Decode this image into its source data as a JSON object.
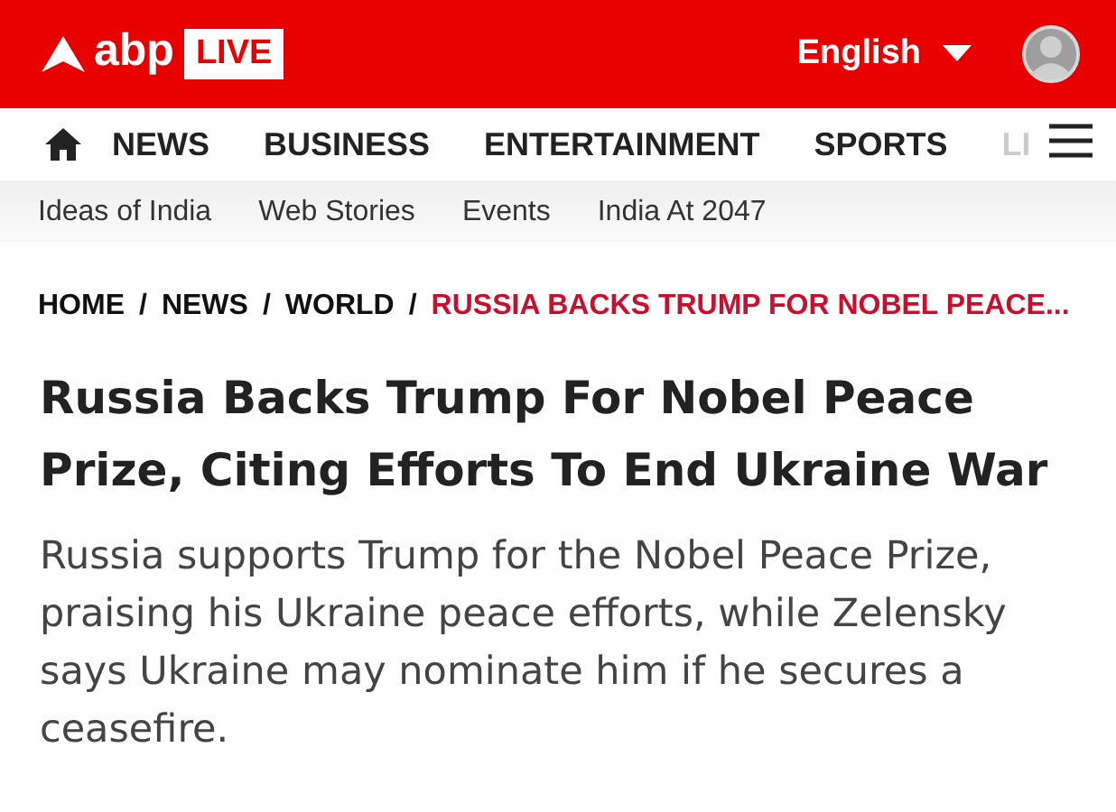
{
  "header": {
    "logo_text": "abp",
    "logo_badge": "LIVE",
    "language": "English"
  },
  "nav": {
    "items": [
      {
        "label": "NEWS"
      },
      {
        "label": "BUSINESS"
      },
      {
        "label": "ENTERTAINMENT"
      },
      {
        "label": "SPORTS"
      },
      {
        "label": "LI"
      }
    ]
  },
  "subnav": {
    "items": [
      "Ideas of India",
      "Web Stories",
      "Events",
      "India At 2047"
    ]
  },
  "breadcrumb": [
    {
      "label": "HOME",
      "current": false
    },
    {
      "label": "NEWS",
      "current": false
    },
    {
      "label": "WORLD",
      "current": false
    },
    {
      "label": "RUSSIA BACKS TRUMP FOR NOBEL PEACE...",
      "current": true
    }
  ],
  "breadcrumb_separator": "/",
  "article": {
    "title": "Russia Backs Trump For Nobel Peace Prize, Citing Efforts To End Ukraine War",
    "summary": "Russia supports Trump for the Nobel Peace Prize, praising his Ukraine peace efforts, while Zelensky says Ukraine may nominate him if he secures a ceasefire."
  }
}
